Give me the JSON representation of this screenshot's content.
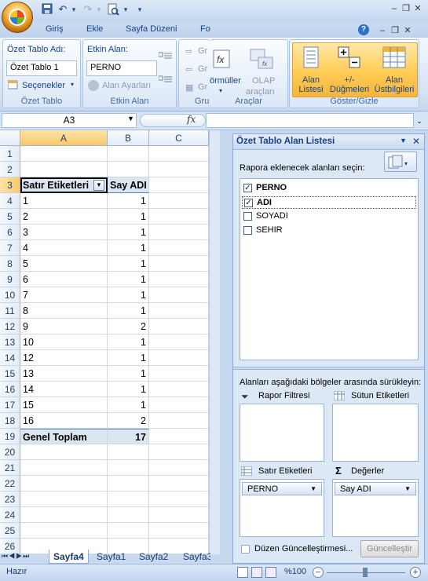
{
  "qat": {
    "save_icon": "save-icon",
    "undo_icon": "undo-icon",
    "redo_icon": "redo-icon",
    "preview_icon": "print-preview-icon",
    "more": "▾"
  },
  "tabs": [
    "Giriş",
    "Ekle",
    "Sayfa Düzeni",
    "Fo"
  ],
  "ribbon": {
    "ozet": {
      "name_label": "Özet Tablo Adı:",
      "name_value": "Özet Tablo 1",
      "options": "Seçenekler",
      "group": "Özet Tablo"
    },
    "etkin": {
      "label": "Etkin Alan:",
      "value": "PERNO",
      "settings": "Alan Ayarları",
      "group": "Etkin Alan"
    },
    "gru": {
      "items": [
        "Gr",
        "Gr",
        "Gr"
      ],
      "group": "Gru"
    },
    "araclar": {
      "formul": "örmüller",
      "olap": "OLAP",
      "olap2": "araçları",
      "group": "Araçlar"
    },
    "goster": {
      "b1a": "Alan",
      "b1b": "Listesi",
      "b2a": "+/-",
      "b2b": "Düğmeleri",
      "b3a": "Alan",
      "b3b": "Üstbilgileri",
      "group": "Göster/Gizle"
    }
  },
  "formula": {
    "namebox": "A3",
    "fx": "fx",
    "value": ""
  },
  "grid": {
    "columns": [
      "A",
      "B",
      "C"
    ],
    "rows": [
      {
        "n": "1",
        "a": "",
        "b": ""
      },
      {
        "n": "2",
        "a": "",
        "b": ""
      },
      {
        "n": "3",
        "a": "Satır Etiketleri",
        "b": "Say ADI"
      },
      {
        "n": "4",
        "a": "1",
        "b": "1"
      },
      {
        "n": "5",
        "a": "2",
        "b": "1"
      },
      {
        "n": "6",
        "a": "3",
        "b": "1"
      },
      {
        "n": "7",
        "a": "4",
        "b": "1"
      },
      {
        "n": "8",
        "a": "5",
        "b": "1"
      },
      {
        "n": "9",
        "a": "6",
        "b": "1"
      },
      {
        "n": "10",
        "a": "7",
        "b": "1"
      },
      {
        "n": "11",
        "a": "8",
        "b": "1"
      },
      {
        "n": "12",
        "a": "9",
        "b": "2"
      },
      {
        "n": "13",
        "a": "10",
        "b": "1"
      },
      {
        "n": "14",
        "a": "12",
        "b": "1"
      },
      {
        "n": "15",
        "a": "13",
        "b": "1"
      },
      {
        "n": "16",
        "a": "14",
        "b": "1"
      },
      {
        "n": "17",
        "a": "15",
        "b": "1"
      },
      {
        "n": "18",
        "a": "16",
        "b": "2"
      },
      {
        "n": "19",
        "a": "Genel Toplam",
        "b": "17"
      },
      {
        "n": "20",
        "a": "",
        "b": ""
      },
      {
        "n": "21",
        "a": "",
        "b": ""
      },
      {
        "n": "22",
        "a": "",
        "b": ""
      },
      {
        "n": "23",
        "a": "",
        "b": ""
      },
      {
        "n": "24",
        "a": "",
        "b": ""
      },
      {
        "n": "25",
        "a": "",
        "b": ""
      },
      {
        "n": "26",
        "a": "",
        "b": ""
      }
    ]
  },
  "sheets": [
    "Sayfa4",
    "Sayfa1",
    "Sayfa2",
    "Sayfa3"
  ],
  "status": {
    "ready": "Hazır",
    "zoom": "%100"
  },
  "pane": {
    "title": "Özet Tablo Alan Listesi",
    "choose_label": "Rapora eklenecek alanları seçin:",
    "fields": [
      {
        "name": "PERNO",
        "checked": true
      },
      {
        "name": "ADI",
        "checked": true
      },
      {
        "name": "SOYADI",
        "checked": false
      },
      {
        "name": "SEHIR",
        "checked": false
      }
    ],
    "drag_label": "Alanları aşağıdaki bölgeler arasında sürükleyin:",
    "report_filter": "Rapor Filtresi",
    "column_labels": "Sütun Etiketleri",
    "row_labels": "Satır Etiketleri",
    "values": "Değerler",
    "row_item": "PERNO",
    "value_item": "Say ADI",
    "defer": "Düzen Güncelleştirmesi...",
    "update": "Güncelleştir"
  }
}
